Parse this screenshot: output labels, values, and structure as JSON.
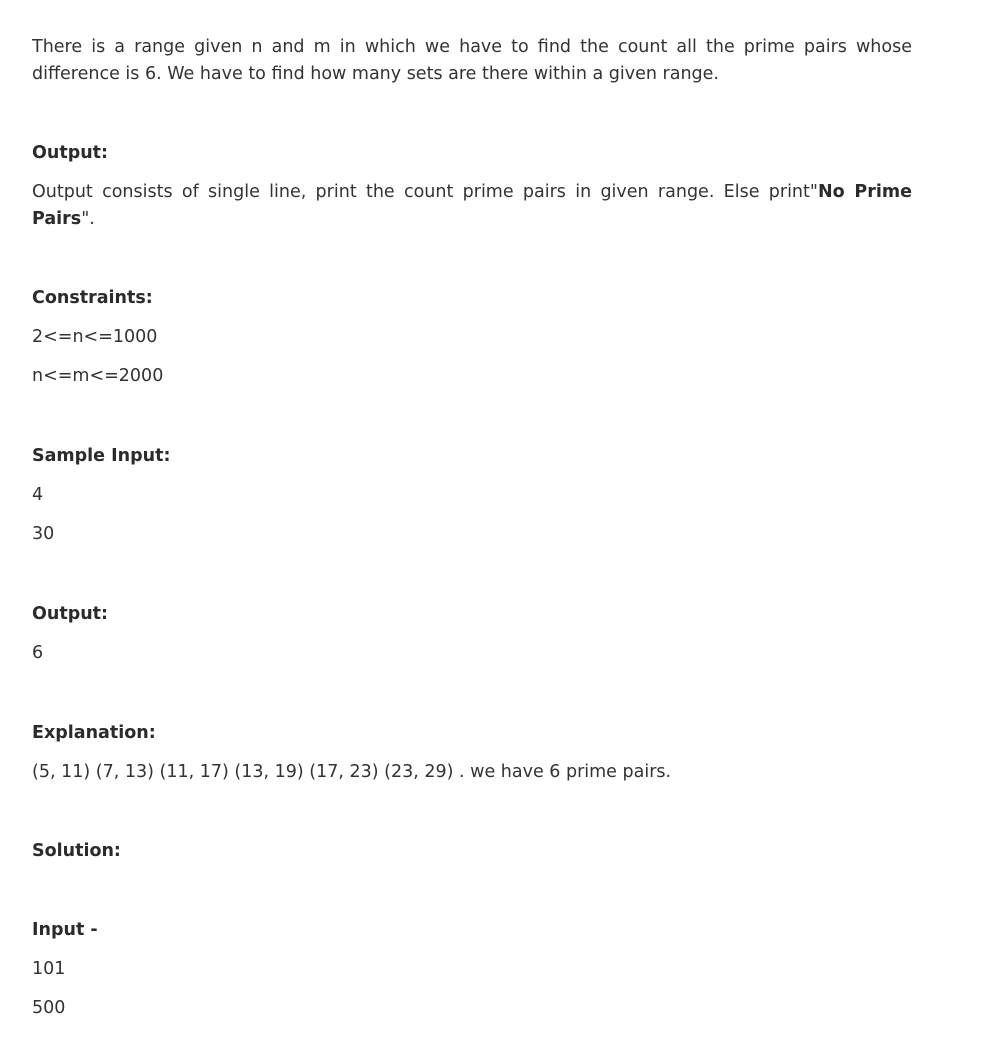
{
  "intro": "There is a range given n and m in which we have to find the count all the prime pairs whose difference is 6. We have to find how many sets are there within a given range.",
  "output_section": {
    "heading": "Output:",
    "text_before": "Output consists of single line, print the count prime pairs in given range. Else print\"",
    "text_bold": "No Prime Pairs",
    "text_after": "\"."
  },
  "constraints_section": {
    "heading": "Constraints:",
    "lines": [
      "2<=n<=1000",
      "n<=m<=2000"
    ]
  },
  "sample_input_section": {
    "heading": "Sample Input:",
    "lines": [
      "4",
      "30"
    ]
  },
  "sample_output_section": {
    "heading": "Output:",
    "lines": [
      "6"
    ]
  },
  "explanation_section": {
    "heading": "Explanation:",
    "text": "(5, 11) (7, 13) (11, 17) (13, 19) (17, 23) (23, 29) . we have 6 prime pairs."
  },
  "solution_section": {
    "heading": "Solution:"
  },
  "input_section": {
    "heading": "Input -",
    "lines": [
      "101",
      "500"
    ]
  }
}
